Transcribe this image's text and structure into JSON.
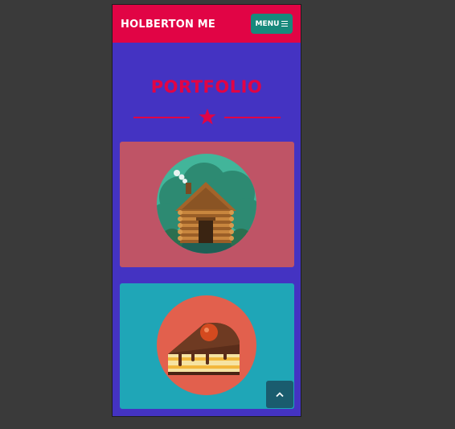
{
  "header": {
    "brand": "HOLBERTON ME",
    "menu_label": "MENU"
  },
  "portfolio": {
    "title": "PORTFOLIO",
    "items": [
      {
        "icon": "log-cabin",
        "background": "#bf5466"
      },
      {
        "icon": "cake-slice",
        "background": "#1fa6b7"
      }
    ]
  },
  "colors": {
    "accent": "#e10445",
    "page_background": "#4433c2",
    "menu_button": "#17897c"
  }
}
